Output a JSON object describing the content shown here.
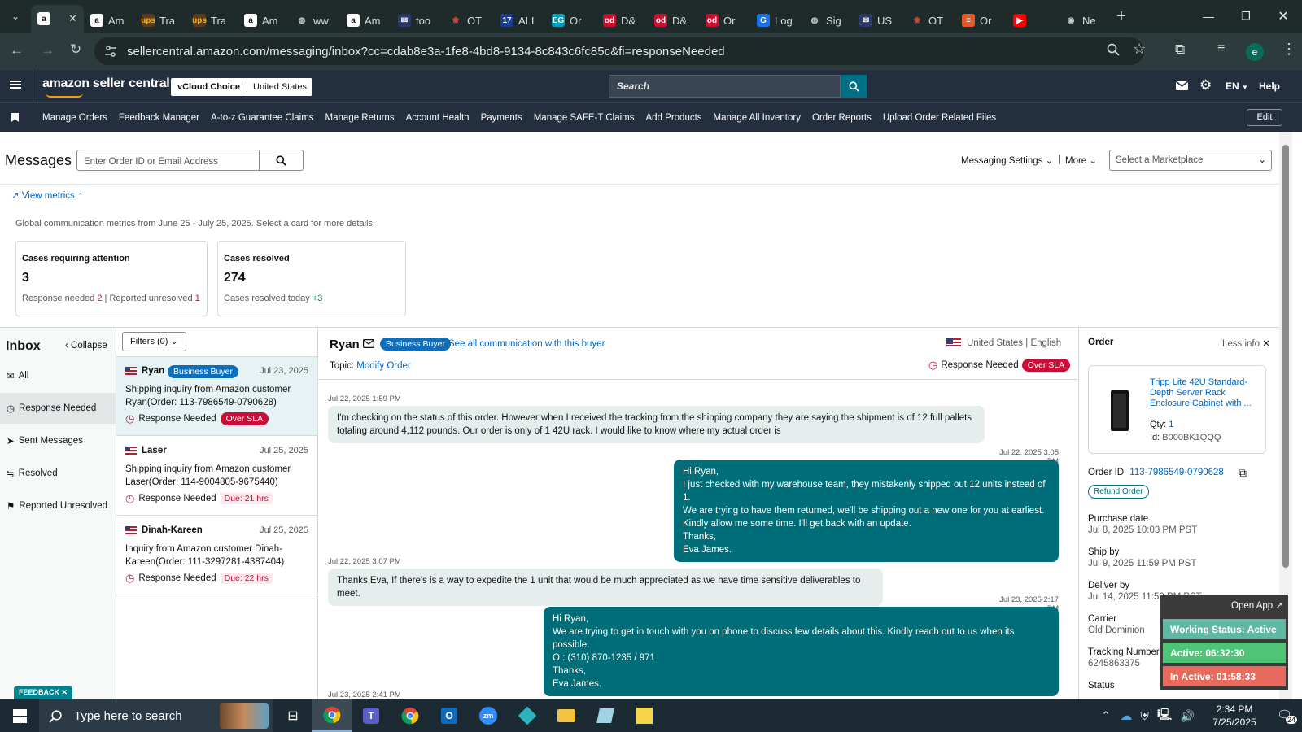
{
  "browser": {
    "tabs": [
      {
        "label": "",
        "fav": "amazon"
      },
      {
        "label": "Am",
        "fav": "amazon"
      },
      {
        "label": "Tra",
        "fav": "ups"
      },
      {
        "label": "Tra",
        "fav": "ups"
      },
      {
        "label": "Am",
        "fav": "amazon"
      },
      {
        "label": "ww",
        "fav": "globe"
      },
      {
        "label": "Am",
        "fav": "amazon"
      },
      {
        "label": "too",
        "fav": "envelope"
      },
      {
        "label": "OT",
        "fav": "ot"
      },
      {
        "label": "ALI",
        "fav": "17"
      },
      {
        "label": "Or",
        "fav": "eg"
      },
      {
        "label": "D&",
        "fav": "od"
      },
      {
        "label": "D&",
        "fav": "od"
      },
      {
        "label": "Or",
        "fav": "od"
      },
      {
        "label": "Log",
        "fav": "g"
      },
      {
        "label": "Sig",
        "fav": "globe"
      },
      {
        "label": "US",
        "fav": "envelope"
      },
      {
        "label": "OT",
        "fav": "ot"
      },
      {
        "label": "Or",
        "fav": "stack"
      },
      {
        "label": "",
        "fav": "youtube"
      },
      {
        "label": "Ne",
        "fav": "chrome"
      }
    ],
    "url": "sellercentral.amazon.com/messaging/inbox?cc=cdab8e3a-1fe8-4bd8-9134-8c843c6fc85c&fi=responseNeeded",
    "profile_initial": "e"
  },
  "header": {
    "logo": "amazon seller central",
    "store": "vCloud Choice",
    "marketplace": "United States",
    "search_placeholder": "Search",
    "lang": "EN",
    "help": "Help"
  },
  "nav": {
    "items": [
      "Manage Orders",
      "Feedback Manager",
      "A-to-z Guarantee Claims",
      "Manage Returns",
      "Account Health",
      "Payments",
      "Manage SAFE-T Claims",
      "Add Products",
      "Manage All Inventory",
      "Order Reports",
      "Upload Order Related Files"
    ],
    "edit": "Edit"
  },
  "page": {
    "title": "Messages",
    "search_placeholder": "Enter Order ID or Email Address",
    "messaging_settings": "Messaging Settings",
    "more": "More",
    "marketplace_select": "Select a Marketplace",
    "view_metrics": "View metrics",
    "metrics_caption": "Global communication metrics from June 25 - July 25, 2025. Select a card for more details."
  },
  "metrics": {
    "attention": {
      "title": "Cases requiring attention",
      "value": "3",
      "resp_label": "Response needed",
      "resp_count": "2",
      "unres_label": "Reported unresolved",
      "unres_count": "1"
    },
    "resolved": {
      "title": "Cases resolved",
      "value": "274",
      "today_label": "Cases resolved today",
      "today_count": "+3"
    }
  },
  "inbox": {
    "title": "Inbox",
    "collapse": "Collapse",
    "filters": "Filters (0)",
    "folders": [
      "All",
      "Response Needed",
      "Sent Messages",
      "Resolved",
      "Reported Unresolved"
    ],
    "cases": [
      {
        "name": "Ryan",
        "badge": "Business Buyer",
        "date": "Jul 23, 2025",
        "subject": "Shipping inquiry from Amazon customer Ryan(Order: 113-7986549-0790628)",
        "status": "Response Needed",
        "sla": "Over SLA"
      },
      {
        "name": "Laser",
        "badge": "",
        "date": "Jul 25, 2025",
        "subject": "Shipping inquiry from Amazon customer Laser(Order: 114-9004805-9675440)",
        "status": "Response Needed",
        "sla": "Due: 21 hrs"
      },
      {
        "name": "Dinah-Kareen",
        "badge": "",
        "date": "Jul 25, 2025",
        "subject": "Inquiry from Amazon customer Dinah-Kareen(Order: 111-3297281-4387404)",
        "status": "Response Needed",
        "sla": "Due: 22 hrs"
      }
    ]
  },
  "conversation": {
    "buyer": "Ryan",
    "badge": "Business Buyer",
    "see_all": "See all communication with this buyer",
    "country": "United States",
    "language": "English",
    "topic_label": "Topic:",
    "topic": "Modify Order",
    "status": "Response Needed",
    "sla": "Over SLA",
    "messages": [
      {
        "dir": "in",
        "time": "Jul 22, 2025 1:59 PM",
        "text": "I'm checking on the status of this order. However when I received the tracking from the shipping company they are saying the shipment is of 12 full pallets totaling around 4,112 pounds. Our order is only of 1 42U rack. I would like to know where my actual order is"
      },
      {
        "dir": "out",
        "time": "Jul 22, 2025 3:05 PM",
        "text": "Hi Ryan,\nI just checked with my warehouse team, they mistakenly shipped out 12 units instead of 1.\nWe are trying to have them returned, we'll be shipping out a new one for you at earliest.\nKindly allow me some time. I'll get back with an update.\nThanks,\nEva James."
      },
      {
        "dir": "in",
        "time": "Jul 22, 2025 3:07 PM",
        "text": "Thanks Eva, If there's is a way to expedite the 1 unit that would be much appreciated as we have time sensitive deliverables to meet."
      },
      {
        "dir": "out",
        "time": "Jul 23, 2025 2:17 PM",
        "text": "Hi Ryan,\nWe are trying to get in touch with you on phone to discuss few details about this. Kindly reach out to us when its possible.\nO : (310) 870-1235 / 971\nThanks,\nEva James."
      },
      {
        "dir": "in",
        "time": "Jul 23, 2025 2:41 PM",
        "text": ""
      }
    ]
  },
  "order": {
    "title": "Order",
    "less_info": "Less info",
    "product_title": "Tripp Lite 42U Standard-Depth Server Rack Enclosure Cabinet with ...",
    "qty_label": "Qty:",
    "qty": "1",
    "id_label": "Id:",
    "asin": "B000BK1QQQ",
    "order_id_label": "Order ID",
    "order_id": "113-7986549-0790628",
    "refund": "Refund Order",
    "fields": [
      {
        "label": "Purchase date",
        "value": "Jul 8, 2025 10:03 PM PST"
      },
      {
        "label": "Ship by",
        "value": "Jul 9, 2025 11:59 PM PST"
      },
      {
        "label": "Deliver by",
        "value": "Jul 14, 2025 11:59 PM PST"
      },
      {
        "label": "Carrier",
        "value": "Old Dominion"
      },
      {
        "label": "Tracking Number",
        "value": "6245863375"
      },
      {
        "label": "Status",
        "value": ""
      }
    ]
  },
  "widget": {
    "open_app": "Open App ↗",
    "working": "Working Status: Active",
    "active": "Active: 06:32:30",
    "inactive": "In Active: 01:58:33"
  },
  "feedback": "FEEDBACK",
  "taskbar": {
    "search_placeholder": "Type here to search",
    "time": "2:34 PM",
    "date": "7/25/2025",
    "notif": "24"
  },
  "colors": {
    "amazon_header": "#232f3e",
    "teal_outgoing": "#006e78",
    "link": "#0066c0",
    "over_sla": "#cc0c39"
  }
}
